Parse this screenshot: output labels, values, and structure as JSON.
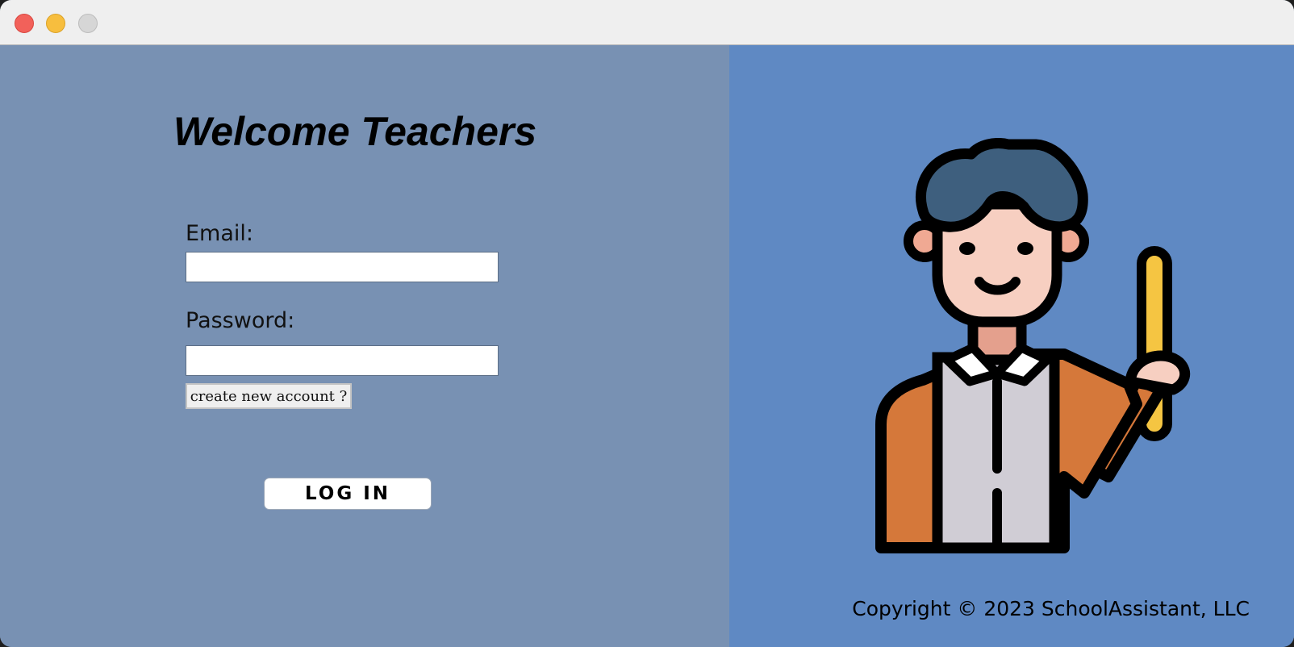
{
  "window": {
    "controls": [
      "close",
      "minimize",
      "maximize"
    ]
  },
  "login": {
    "title": "Welcome Teachers",
    "email_label": "Email:",
    "email_value": "",
    "password_label": "Password:",
    "password_value": "",
    "create_account_label": "create new account ?",
    "login_label": "LOG IN"
  },
  "footer": {
    "copyright": "Copyright © 2023 SchoolAssistant, LLC"
  },
  "illustration": {
    "icon": "teacher-pointer-icon"
  },
  "colors": {
    "left_panel": "#7891b3",
    "right_panel": "#5f89c3",
    "hair": "#3e5f7e",
    "skin": "#f7cfc1",
    "jacket": "#d5783a",
    "shirt": "#d0cdd5",
    "pointer": "#f5c542"
  }
}
